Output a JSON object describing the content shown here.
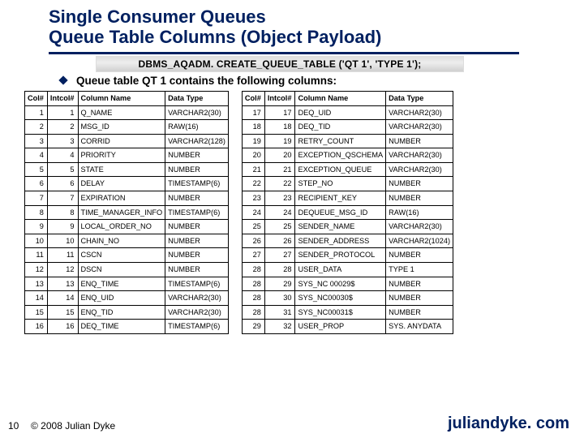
{
  "title_line1": "Single Consumer Queues",
  "title_line2": "Queue Table Columns (Object Payload)",
  "sql": "DBMS_AQADM. CREATE_QUEUE_TABLE ('QT 1', 'TYPE 1');",
  "bullet": "Queue table QT 1 contains the following columns:",
  "headers": {
    "col": "Col#",
    "intcol": "Intcol#",
    "name": "Column Name",
    "type": "Data Type"
  },
  "left_rows": [
    {
      "c": 1,
      "i": 1,
      "n": "Q_NAME",
      "t": "VARCHAR2(30)"
    },
    {
      "c": 2,
      "i": 2,
      "n": "MSG_ID",
      "t": "RAW(16)"
    },
    {
      "c": 3,
      "i": 3,
      "n": "CORRID",
      "t": "VARCHAR2(128)"
    },
    {
      "c": 4,
      "i": 4,
      "n": "PRIORITY",
      "t": "NUMBER"
    },
    {
      "c": 5,
      "i": 5,
      "n": "STATE",
      "t": "NUMBER"
    },
    {
      "c": 6,
      "i": 6,
      "n": "DELAY",
      "t": "TIMESTAMP(6)"
    },
    {
      "c": 7,
      "i": 7,
      "n": "EXPIRATION",
      "t": "NUMBER"
    },
    {
      "c": 8,
      "i": 8,
      "n": "TIME_MANAGER_INFO",
      "t": "TIMESTAMP(6)"
    },
    {
      "c": 9,
      "i": 9,
      "n": "LOCAL_ORDER_NO",
      "t": "NUMBER"
    },
    {
      "c": 10,
      "i": 10,
      "n": "CHAIN_NO",
      "t": "NUMBER"
    },
    {
      "c": 11,
      "i": 11,
      "n": "CSCN",
      "t": "NUMBER"
    },
    {
      "c": 12,
      "i": 12,
      "n": "DSCN",
      "t": "NUMBER"
    },
    {
      "c": 13,
      "i": 13,
      "n": "ENQ_TIME",
      "t": "TIMESTAMP(6)"
    },
    {
      "c": 14,
      "i": 14,
      "n": "ENQ_UID",
      "t": "VARCHAR2(30)"
    },
    {
      "c": 15,
      "i": 15,
      "n": "ENQ_TID",
      "t": "VARCHAR2(30)"
    },
    {
      "c": 16,
      "i": 16,
      "n": "DEQ_TIME",
      "t": "TIMESTAMP(6)"
    }
  ],
  "right_rows": [
    {
      "c": 17,
      "i": 17,
      "n": "DEQ_UID",
      "t": "VARCHAR2(30)"
    },
    {
      "c": 18,
      "i": 18,
      "n": "DEQ_TID",
      "t": "VARCHAR2(30)"
    },
    {
      "c": 19,
      "i": 19,
      "n": "RETRY_COUNT",
      "t": "NUMBER"
    },
    {
      "c": 20,
      "i": 20,
      "n": "EXCEPTION_QSCHEMA",
      "t": "VARCHAR2(30)"
    },
    {
      "c": 21,
      "i": 21,
      "n": "EXCEPTION_QUEUE",
      "t": "VARCHAR2(30)"
    },
    {
      "c": 22,
      "i": 22,
      "n": "STEP_NO",
      "t": "NUMBER"
    },
    {
      "c": 23,
      "i": 23,
      "n": "RECIPIENT_KEY",
      "t": "NUMBER"
    },
    {
      "c": 24,
      "i": 24,
      "n": "DEQUEUE_MSG_ID",
      "t": "RAW(16)"
    },
    {
      "c": 25,
      "i": 25,
      "n": "SENDER_NAME",
      "t": "VARCHAR2(30)"
    },
    {
      "c": 26,
      "i": 26,
      "n": "SENDER_ADDRESS",
      "t": "VARCHAR2(1024)"
    },
    {
      "c": 27,
      "i": 27,
      "n": "SENDER_PROTOCOL",
      "t": "NUMBER"
    },
    {
      "c": 28,
      "i": 28,
      "n": "USER_DATA",
      "t": "TYPE 1"
    },
    {
      "c": 28,
      "i": 29,
      "n": "SYS_NC 00029$",
      "t": "NUMBER"
    },
    {
      "c": 28,
      "i": 30,
      "n": "SYS_NC00030$",
      "t": "NUMBER"
    },
    {
      "c": 28,
      "i": 31,
      "n": "SYS_NC00031$",
      "t": "NUMBER"
    },
    {
      "c": 29,
      "i": 32,
      "n": "USER_PROP",
      "t": "SYS. ANYDATA"
    }
  ],
  "page": "10",
  "copyright": "© 2008 Julian Dyke",
  "site": "juliandyke. com"
}
